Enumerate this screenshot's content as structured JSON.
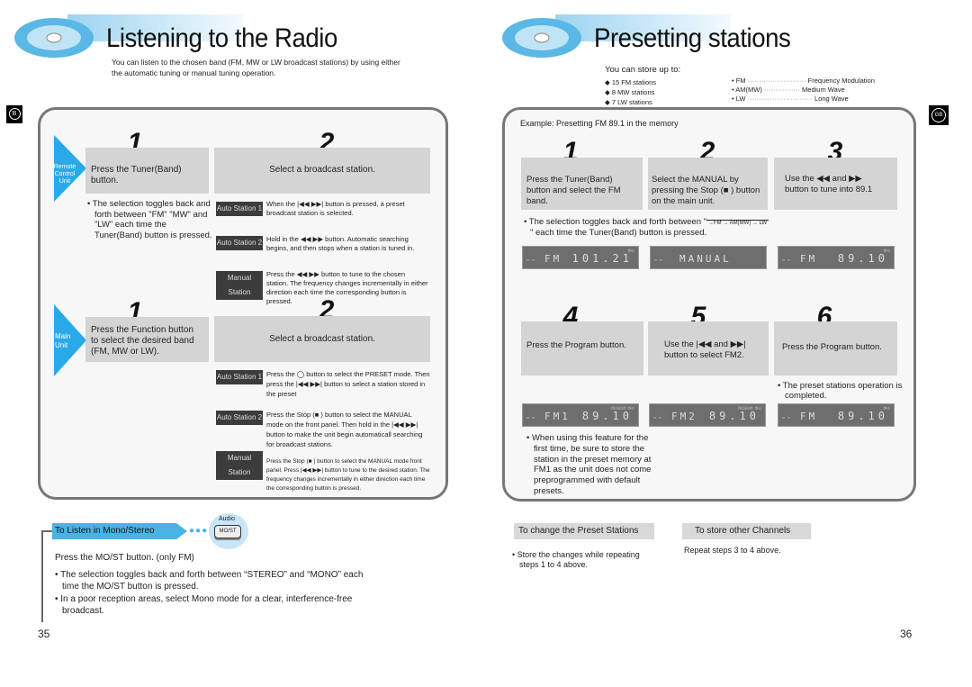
{
  "left_page": {
    "title": "Listening to the Radio",
    "intro_line1": "You can listen to the chosen band (FM, MW or LW broadcast stations) by using either",
    "intro_line2": "the automatic tuning or manual tuning operation.",
    "lang_badge": "B",
    "remote": {
      "label_lines": [
        "Remote",
        "Control",
        "Unit"
      ],
      "step1_num": "1",
      "step1_text": "Press the Tuner(Band) button.",
      "step1_note": "The selection toggles back and forth between \"FM\" \"MW\" and \"LW\" each time the Tuner(Band)  button is pressed.",
      "step2_num": "2",
      "step2_text": "Select a broadcast station.",
      "modes": [
        {
          "tag": "Auto Station 1",
          "text": "When the |◀◀ ▶▶| button is pressed, a preset broadcast station is selected."
        },
        {
          "tag": "Auto Station 2",
          "text": "Hold in the ◀◀ ▶▶ button. Automatic searching begins, and then stops when a station is tuned in."
        },
        {
          "tag": "Manual Station",
          "text": "Press the ◀◀ ▶▶ button to tune to the chosen station. The frequency changes incrementally in either direction each time the corresponding button is pressed."
        }
      ]
    },
    "main": {
      "label_lines": [
        "Main",
        "Unit"
      ],
      "step1_num": "1",
      "step1_text": "Press the Function  button to select the desired band (FM, MW or LW).",
      "step2_num": "2",
      "step2_text": "Select a broadcast station.",
      "modes": [
        {
          "tag": "Auto Station 1",
          "text": "Press the ◯ button to select the PRESET mode. Then press the |◀◀ ▶▶| button to select a station stored in the preset"
        },
        {
          "tag": "Auto Station 2",
          "text": "Press the Stop (■ ) button to select the MANUAL mode on the front panel. Then hold in the |◀◀ ▶▶| button to make the unit begin automaticall searching for broadcast stations."
        },
        {
          "tag": "Manual Station",
          "text": "Press the Stop (■ ) button to select the MANUAL mode front panel. Press |◀◀ ▶▶| button to tune to the desired station. The frequency changes incrementally in either direction each time the corresponding button is pressed."
        }
      ]
    },
    "mono": {
      "header": "To Listen in Mono/Stereo",
      "button_caption": "Audio",
      "button_label": "MO/ST",
      "instruction": "Press the MO/ST button.   (only FM)",
      "bullets": [
        "The selection toggles back and forth between “STEREO” and “MONO” each time the MO/ST button is pressed.",
        "In a poor reception areas, select Mono mode for a clear, interference-free broadcast."
      ]
    },
    "page_number": "35"
  },
  "right_page": {
    "title": "Presetting stations",
    "store_intro": "You can store up to:",
    "store_items": [
      "15 FM stations",
      "8 MW stations",
      "7 LW stations"
    ],
    "legend": [
      {
        "band": "• FM",
        "meaning": "Frequency Modulation"
      },
      {
        "band": "• AM(MW)",
        "meaning": "Medium Wave"
      },
      {
        "band": "• LW",
        "meaning": "Long Wave"
      }
    ],
    "lang_badge": "GB",
    "example_title": "Example: Presetting FM 89.1 in the memory",
    "steps": [
      {
        "num": "1",
        "text": "Press the Tuner(Band)  button and select the FM band.",
        "lcd_left": "FM",
        "lcd_right": "101.21",
        "lcd_ind": "MHz"
      },
      {
        "num": "2",
        "text": "Select the MANUAL by pressing the Stop (■ ) button on the main unit.",
        "lcd_left": "MANUAL",
        "lcd_right": "",
        "lcd_ind": ""
      },
      {
        "num": "3",
        "text": "Use the ◀◀  and ▶▶ button to tune into 89.1",
        "lcd_left": "FM",
        "lcd_right": "89.10",
        "lcd_ind": "MHz"
      },
      {
        "num": "4",
        "text": "Press the Program  button.",
        "lcd_left": "FM1",
        "lcd_right": "89.10",
        "lcd_ind": "PROGRAM   MHz"
      },
      {
        "num": "5",
        "text": "Use the |◀◀  and ▶▶| button to select FM2.",
        "lcd_left": "FM2",
        "lcd_right": "89.10",
        "lcd_ind": "PROGRAM   MHz"
      },
      {
        "num": "6",
        "text": "Press the Program  button.",
        "lcd_left": "FM",
        "lcd_right": "89.10",
        "lcd_ind": "MHz"
      }
    ],
    "toggle_note_line1": "The selection toggles back and forth between \"",
    "toggle_sequence": "→FM → AM(MW) → LW",
    "toggle_note_line2": "\" each time the Tuner(Band)  button is pressed.",
    "completed_note": "The preset stations operation is completed.",
    "first_time_note": "When using this feature for the first time, be sure to store the station in the preset memory at FM1 as the unit does not come preprogrammed with default presets.",
    "change_header": "To change the Preset Stations",
    "change_text": "Store the changes while repeating steps 1 to 4 above.",
    "other_header": "To store other Channels",
    "other_text": "Repeat steps 3 to 4 above.",
    "page_number": "36"
  }
}
